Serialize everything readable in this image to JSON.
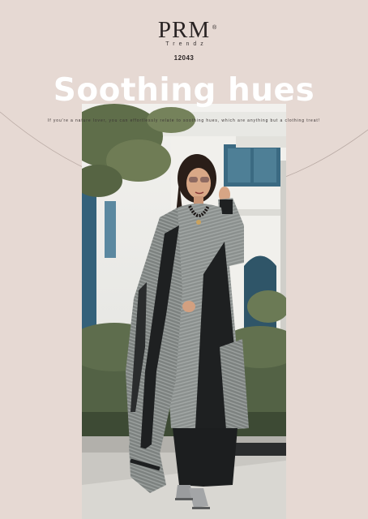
{
  "brand": {
    "name": "PRM",
    "registered_mark": "®",
    "subname": "Trendz",
    "catalog_number": "12043"
  },
  "headline": "Soothing hues",
  "tagline": "If you're a nature lover, you can effortlessly relate to soothing hues, which are anything but a clothing treat!",
  "colors": {
    "background": "#e6d9d3",
    "headline": "#ffffff",
    "brand_text": "#2a2424",
    "outfit_grey": "#8a8f8d",
    "outfit_black": "#1c1e1f"
  }
}
